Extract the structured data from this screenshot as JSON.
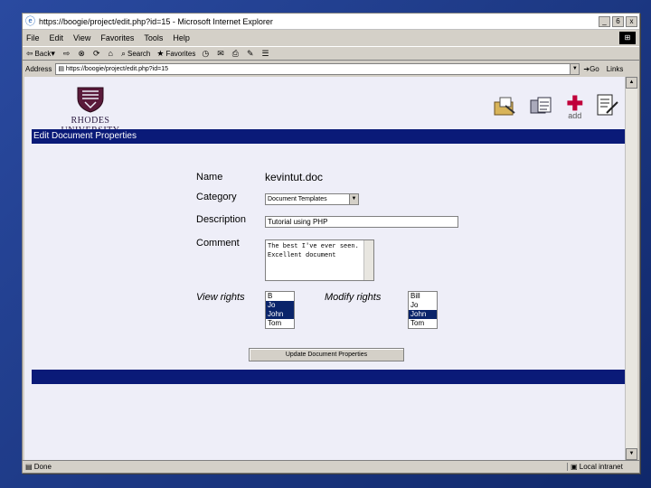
{
  "window": {
    "title": "https://boogie/project/edit.php?id=15 - Microsoft Internet Explorer",
    "min_label": "_",
    "max_label": "6",
    "close_label": "x"
  },
  "menu": {
    "items": [
      "File",
      "Edit",
      "View",
      "Favorites",
      "Tools",
      "Help"
    ]
  },
  "toolbar": {
    "back_label": "Back",
    "search_label": "Search",
    "favorites_label": "Favorites"
  },
  "address": {
    "label": "Address",
    "url": "https://boogie/project/edit.php?id=15",
    "go_label": "Go",
    "links_label": "Links"
  },
  "page": {
    "university": "RHODES UNIVERSITY",
    "add_label": "add",
    "header_title": "Edit Document Properties",
    "name_label": "Name",
    "name_value": "kevintut.doc",
    "category_label": "Category",
    "category_value": "Document Templates",
    "description_label": "Description",
    "description_value": "Tutorial using PHP",
    "comment_label": "Comment",
    "comment_value": "The best I've ever seen. Excellent document",
    "view_rights_label": "View rights",
    "modify_rights_label": "Modify rights",
    "view_rights": [
      {
        "label": "B",
        "selected": false
      },
      {
        "label": "Jo",
        "selected": true
      },
      {
        "label": "John",
        "selected": true
      },
      {
        "label": "Tom",
        "selected": false
      }
    ],
    "modify_rights": [
      {
        "label": "Bill",
        "selected": false
      },
      {
        "label": "Jo",
        "selected": false
      },
      {
        "label": "John",
        "selected": true
      },
      {
        "label": "Tom",
        "selected": false
      }
    ],
    "update_button": "Update Document Properties"
  },
  "status": {
    "left_text": "Done",
    "zone_text": "Local intranet"
  },
  "colors": {
    "header_bar": "#0a1a78",
    "selection": "#0a246a",
    "add_icon": "#c0003a"
  }
}
